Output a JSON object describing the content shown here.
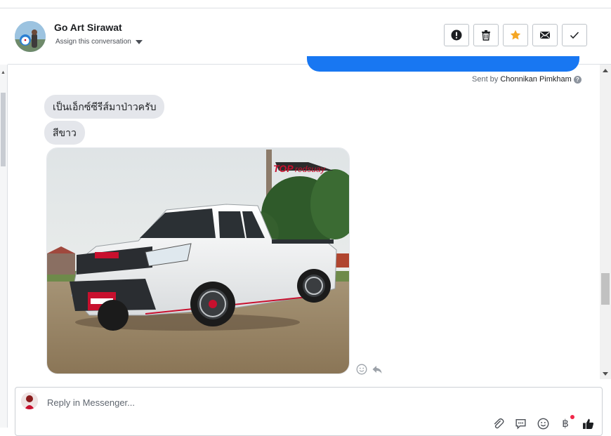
{
  "header": {
    "contact_name": "Go Art Sirawat",
    "assign_label": "Assign this conversation",
    "actions": [
      {
        "name": "spam-button",
        "icon": "alert-circle-icon"
      },
      {
        "name": "delete-button",
        "icon": "trash-icon"
      },
      {
        "name": "follow-up-button",
        "icon": "star-icon",
        "color": "#f5a623"
      },
      {
        "name": "mark-unread-button",
        "icon": "envelope-icon"
      },
      {
        "name": "mark-done-button",
        "icon": "check-icon"
      }
    ]
  },
  "thread": {
    "sent_by_prefix": "Sent by",
    "sent_by_name": "Chonnikan Pimkham",
    "messages": [
      {
        "text": "เป็นเอ็กซ์ซีรีส์มาป่าวครับ"
      },
      {
        "text": "สีขาว"
      }
    ],
    "photo": {
      "alt": "white pickup truck photo",
      "watermark": "TOPredsuay",
      "plate_text": "TOPredsuay"
    }
  },
  "composer": {
    "placeholder": "Reply in Messenger...",
    "tools": [
      "paperclip-icon",
      "saved-replies-icon",
      "emoji-icon",
      "baht-payment-icon",
      "like-icon"
    ]
  },
  "colors": {
    "outgoing_bubble": "#1877f2",
    "incoming_bubble": "#e4e6eb",
    "star": "#f5a623"
  }
}
